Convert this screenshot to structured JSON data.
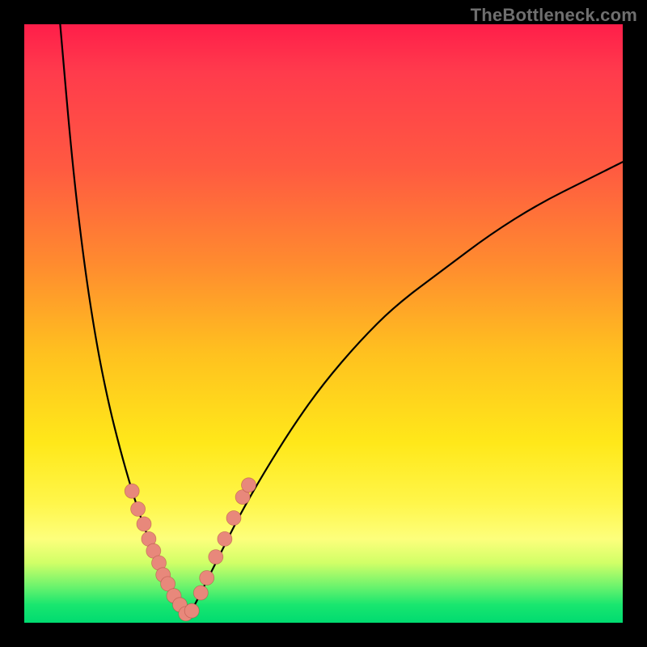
{
  "watermark": "TheBottleneck.com",
  "chart_data": {
    "type": "line",
    "title": "",
    "xlabel": "",
    "ylabel": "",
    "xlim": [
      0,
      100
    ],
    "ylim": [
      0,
      100
    ],
    "inner_size_px": 740,
    "series": [
      {
        "name": "left-curve",
        "x": [
          6,
          8,
          10,
          12,
          14,
          16,
          18,
          20,
          22,
          24,
          26,
          27
        ],
        "y": [
          100,
          77,
          60,
          47,
          37,
          29,
          22,
          16,
          11,
          7,
          3,
          1
        ]
      },
      {
        "name": "right-curve",
        "x": [
          27,
          28,
          30,
          33,
          36,
          40,
          45,
          50,
          56,
          62,
          70,
          78,
          86,
          94,
          100
        ],
        "y": [
          1,
          2,
          6,
          12,
          18,
          25,
          33,
          40,
          47,
          53,
          59,
          65,
          70,
          74,
          77
        ]
      }
    ],
    "dots": {
      "name": "bottleneck-markers",
      "x": [
        18.0,
        19.0,
        20.0,
        20.8,
        21.6,
        22.5,
        23.2,
        24.0,
        25.0,
        26.0,
        27.0,
        28.0,
        29.5,
        30.5,
        32.0,
        33.5,
        35.0,
        36.5,
        37.5
      ],
      "y": [
        22.0,
        19.0,
        16.5,
        14.0,
        12.0,
        10.0,
        8.0,
        6.5,
        4.5,
        3.0,
        1.5,
        2.0,
        5.0,
        7.5,
        11.0,
        14.0,
        17.5,
        21.0,
        23.0
      ],
      "r": 9
    },
    "colors": {
      "bg_top": "#ff1e4a",
      "bg_bottom": "#00db70",
      "curve": "#000000",
      "dot": "#e8887b",
      "frame": "#000000"
    }
  }
}
